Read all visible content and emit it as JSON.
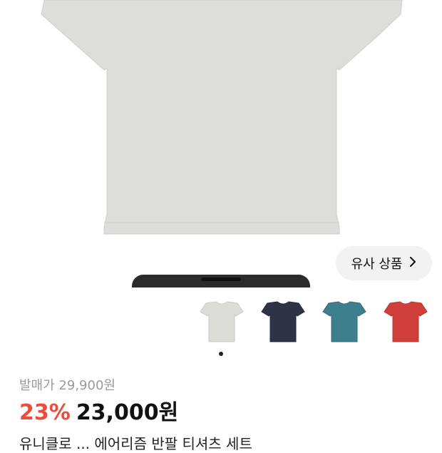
{
  "similar_button": {
    "label": "유사 상품",
    "icon": "chevron-right-icon"
  },
  "colors": {
    "shirt_main": "#dddedb",
    "thumb_colors": [
      "#dcdcd8",
      "#2e3346",
      "#3e7f8e",
      "#d13f3b",
      "#c8c8c8"
    ],
    "discount": "#ef4b3c"
  },
  "thumbnails": [
    {
      "name": "heather-gray"
    },
    {
      "name": "navy"
    },
    {
      "name": "teal"
    },
    {
      "name": "red"
    },
    {
      "name": "partial-gray"
    }
  ],
  "pager": {
    "current": 1,
    "total": 1
  },
  "price": {
    "original_label": "발매가",
    "original_value": "29,900원",
    "discount": "23%",
    "sale": "23,000원"
  },
  "product_title": "유니클로 ... 에어리즘 반팔 티셔츠 세트"
}
